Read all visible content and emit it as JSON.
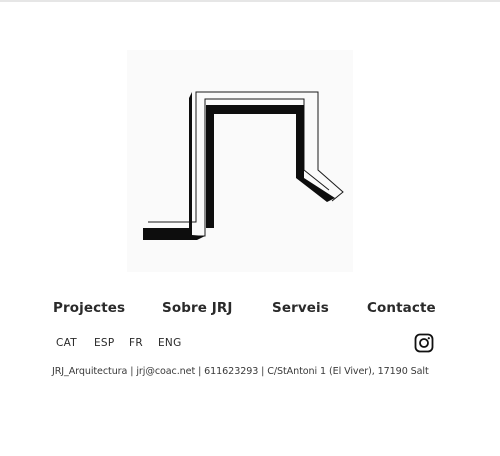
{
  "logo": {
    "alt": "JRJ logo mark"
  },
  "nav": {
    "items": [
      {
        "label": "Projectes"
      },
      {
        "label": "Sobre JRJ"
      },
      {
        "label": "Serveis"
      },
      {
        "label": "Contacte"
      }
    ]
  },
  "languages": {
    "items": [
      {
        "label": "CAT"
      },
      {
        "label": "ESP"
      },
      {
        "label": "FR"
      },
      {
        "label": "ENG"
      }
    ]
  },
  "social": {
    "icon": "instagram-icon"
  },
  "footer": {
    "name": "JRJ_Arquitectura",
    "email": "jrj@coac.net",
    "phone": "611623293",
    "address": "C/StAntoni 1 (El Viver), 17190 Salt",
    "separator": " | "
  }
}
